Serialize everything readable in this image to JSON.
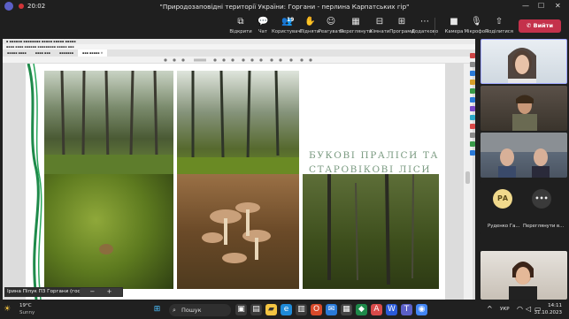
{
  "window": {
    "timer": "20:02",
    "meeting_title": "\"Природозаповідні території України: Горгани - перлина Карпатських гір\""
  },
  "toolbar": {
    "items": [
      {
        "label": "Відкрити",
        "icon": "open-icon"
      },
      {
        "label": "Чат",
        "icon": "chat-icon"
      },
      {
        "label": "Користувачі",
        "icon": "people-icon",
        "badge": "19"
      },
      {
        "label": "Підняти",
        "icon": "raise-hand-icon"
      },
      {
        "label": "Реагувати",
        "icon": "react-icon"
      },
      {
        "label": "Переглянути",
        "icon": "view-icon"
      },
      {
        "label": "Кімнати",
        "icon": "rooms-icon"
      },
      {
        "label": "Програми",
        "icon": "apps-icon"
      },
      {
        "label": "Додатково",
        "icon": "more-icon"
      }
    ],
    "camera_label": "Камера",
    "mic_label": "Мікрофон",
    "share_label": "Поділитися",
    "leave_label": "Вийти"
  },
  "shared_screen": {
    "slide_title": "БУКОВІ ПРАЛІСИ ТА СТАРОВІКОВІ ЛІСИ"
  },
  "participants": [
    {
      "initials": "РА",
      "name": "Руденко Га...",
      "avatar_color": "#f0d98c"
    },
    {
      "initials": "•••",
      "name": "Переглянути в..."
    }
  ],
  "presenter": {
    "label": "Ірина Піпук ПЗ Горгани (гость)",
    "zoom_minus": "−",
    "zoom_plus": "+"
  },
  "taskbar": {
    "weather_temp": "19°C",
    "weather_desc": "Sunny",
    "search_label": "Пошук",
    "lang": "УКР",
    "time": "14:11",
    "date": "31.10.2023"
  },
  "colors": {
    "leave": "#c4314b",
    "slide_title": "#7a9a80",
    "accent_green": "#1e8a4a"
  }
}
